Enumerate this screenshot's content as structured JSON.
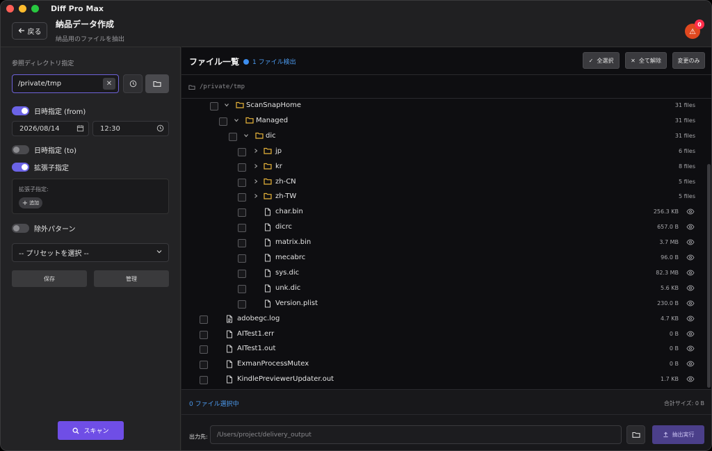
{
  "app": {
    "title": "Diff Pro Max",
    "alert_count": "0"
  },
  "header": {
    "back_label": "戻る",
    "title": "納品データ作成",
    "subtitle": "納品用のファイルを抽出"
  },
  "sidebar": {
    "ref_dir_label": "参照ディレクトリ指定",
    "dir_value": "/private/tmp",
    "datetime_from_label": "日時指定 (from)",
    "date_value": "2026/08/14",
    "time_value": "12:30",
    "datetime_to_label": "日時指定 (to)",
    "ext_label": "拡張子指定",
    "ext_box_label": "拡張子指定:",
    "add_label": "追加",
    "exclude_label": "除外パターン",
    "preset_placeholder": "-- プリセットを選択 --",
    "save_label": "保存",
    "manage_label": "管理",
    "scan_label": "スキャン"
  },
  "main": {
    "list_title": "ファイル一覧",
    "detected": "1 ファイル検出",
    "select_all": "全選択",
    "deselect_all": "全て解除",
    "changed_only": "変更のみ",
    "path": "/private/tmp",
    "selected_count": "0 ファイル選択中",
    "total_size": "合計サイズ: 0 B",
    "output_label": "出力先:",
    "output_path": "/Users/project/delivery_output",
    "exec_label": "抽出実行"
  },
  "rows": [
    {
      "name": "ScanSnapHome",
      "size": "31 files"
    },
    {
      "name": "Managed",
      "size": "31 files"
    },
    {
      "name": "dic",
      "size": "31 files"
    },
    {
      "name": "jp",
      "size": "6 files"
    },
    {
      "name": "kr",
      "size": "8 files"
    },
    {
      "name": "zh-CN",
      "size": "5 files"
    },
    {
      "name": "zh-TW",
      "size": "5 files"
    },
    {
      "name": "char.bin",
      "size": "256.3 KB"
    },
    {
      "name": "dicrc",
      "size": "657.0 B"
    },
    {
      "name": "matrix.bin",
      "size": "3.7 MB"
    },
    {
      "name": "mecabrc",
      "size": "96.0 B"
    },
    {
      "name": "sys.dic",
      "size": "82.3 MB"
    },
    {
      "name": "unk.dic",
      "size": "5.6 KB"
    },
    {
      "name": "Version.plist",
      "size": "230.0 B"
    },
    {
      "name": "adobegc.log",
      "size": "4.7 KB"
    },
    {
      "name": "AITest1.err",
      "size": "0 B"
    },
    {
      "name": "AITest1.out",
      "size": "0 B"
    },
    {
      "name": "ExmanProcessMutex",
      "size": "0 B"
    },
    {
      "name": "KindlePreviewerUpdater.out",
      "size": "1.7 KB"
    }
  ]
}
